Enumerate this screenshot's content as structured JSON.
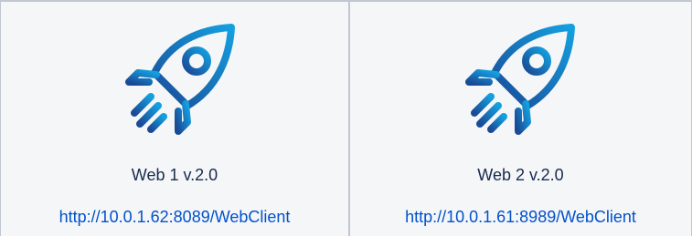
{
  "cards": [
    {
      "icon": "rocket-icon",
      "title": "Web 1 v.2.0",
      "link": "http://10.0.1.62:8089/WebClient"
    },
    {
      "icon": "rocket-icon",
      "title": "Web 2 v.2.0",
      "link": "http://10.0.1.61:8989/WebClient"
    }
  ],
  "colors": {
    "icon_gradient_start": "#1a4a96",
    "icon_gradient_end": "#14a0e0",
    "link": "#0052cc",
    "card_background": "#f5f6f8"
  }
}
